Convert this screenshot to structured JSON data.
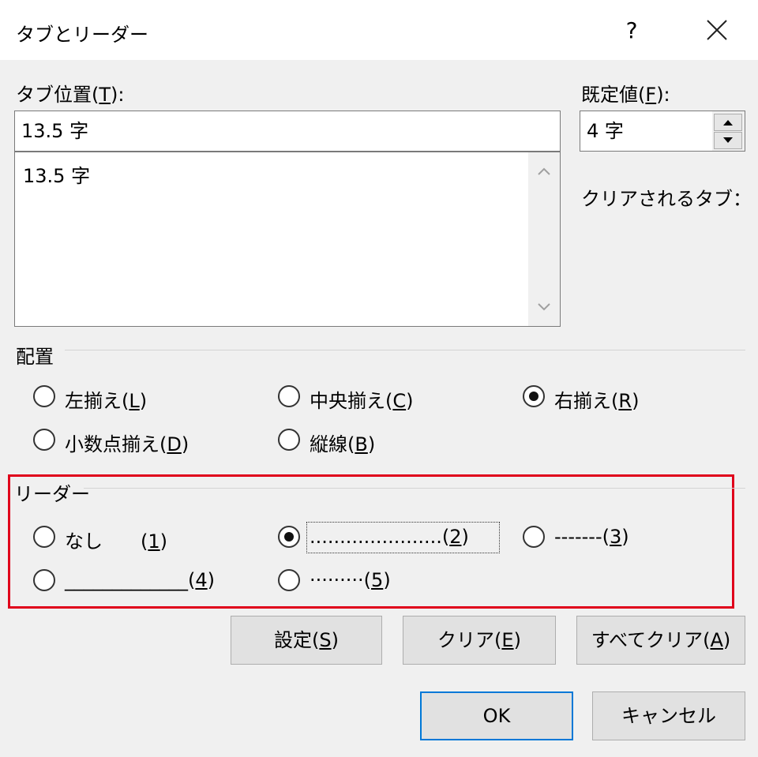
{
  "window": {
    "title": "タブとリーダー",
    "help_label": "?"
  },
  "tab_position": {
    "label_prefix": "タブ位置(",
    "label_key": "T",
    "label_suffix": "):",
    "value": "13.5 字",
    "list": [
      "13.5 字"
    ]
  },
  "default_tabs": {
    "label_prefix": "既定値(",
    "label_key": "F",
    "label_suffix": "):",
    "value": "4 字"
  },
  "tabs_to_clear": {
    "label": "クリアされるタブ："
  },
  "alignment": {
    "title": "配置",
    "options": [
      {
        "prefix": "左揃え(",
        "key": "L",
        "suffix": ")",
        "checked": false
      },
      {
        "prefix": "中央揃え(",
        "key": "C",
        "suffix": ")",
        "checked": false
      },
      {
        "prefix": "右揃え(",
        "key": "R",
        "suffix": ")",
        "checked": true
      },
      {
        "prefix": "小数点揃え(",
        "key": "D",
        "suffix": ")",
        "checked": false
      },
      {
        "prefix": "縦線(",
        "key": "B",
        "suffix": ")",
        "checked": false
      }
    ]
  },
  "leader": {
    "title": "リーダー",
    "options": [
      {
        "prefix": "なし　　(",
        "key": "1",
        "suffix": ")",
        "checked": false
      },
      {
        "prefix": "......................(",
        "key": "2",
        "suffix": ")",
        "checked": true
      },
      {
        "prefix": "-------(",
        "key": "3",
        "suffix": ")",
        "checked": false
      },
      {
        "prefix": "_____________(",
        "key": "4",
        "suffix": ")",
        "checked": false
      },
      {
        "prefix": "·········(",
        "key": "5",
        "suffix": ")",
        "checked": false
      }
    ]
  },
  "buttons": {
    "set": {
      "prefix": "設定(",
      "key": "S",
      "suffix": ")"
    },
    "clear": {
      "prefix": "クリア(",
      "key": "E",
      "suffix": ")"
    },
    "clear_all": {
      "prefix": "すべてクリア(",
      "key": "A",
      "suffix": ")"
    },
    "ok": "OK",
    "cancel": "キャンセル"
  }
}
